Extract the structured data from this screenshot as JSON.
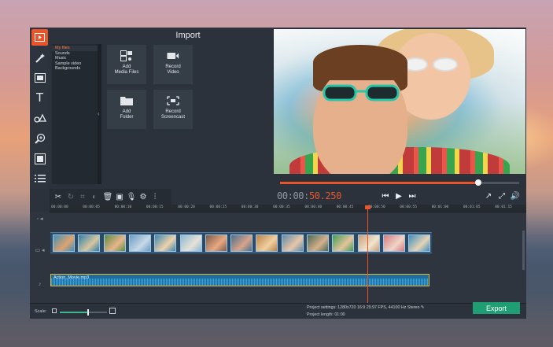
{
  "sidebar": {
    "tools": [
      "import-icon",
      "magic-wand-icon",
      "filters-icon",
      "titles-icon",
      "shapes-icon",
      "zoom-icon",
      "transitions-icon",
      "menu-icon"
    ]
  },
  "import_panel": {
    "title": "Import",
    "folders": [
      "My files",
      "Sounds",
      "Music",
      "Sample video",
      "Backgrounds"
    ],
    "tiles": [
      {
        "label": "Add\nMedia Files",
        "icon": "media-files-icon"
      },
      {
        "label": "Record\nVideo",
        "icon": "camera-icon"
      },
      {
        "label": "Add\nFolder",
        "icon": "folder-icon"
      },
      {
        "label": "Record\nScreencast",
        "icon": "screencast-icon"
      }
    ]
  },
  "player": {
    "timecode_prefix": "00:00:",
    "timecode_highlight": "50.250",
    "progress": 0.83
  },
  "timeline": {
    "ruler": [
      "00:00:00",
      "00:00:05",
      "00:00:10",
      "00:00:15",
      "00:00:20",
      "00:00:25",
      "00:00:30",
      "00:00:35",
      "00:00:40",
      "00:00:45",
      "00:00:50",
      "00:00:55",
      "00:01:00",
      "00:01:05",
      "00:01:15"
    ],
    "audio_clip": "Action_Movie.mp3"
  },
  "bottom": {
    "scale_label": "Scale:",
    "project_settings_label": "Project settings:",
    "project_settings_value": "1280x720 16:9 29.97 FPS, 44100 Hz Stereo",
    "project_length_label": "Project length:",
    "project_length_value": "01:00",
    "export_label": "Export"
  },
  "colors": {
    "accent": "#e8552b",
    "export": "#1f9e74",
    "app_bg": "#2b323b"
  }
}
